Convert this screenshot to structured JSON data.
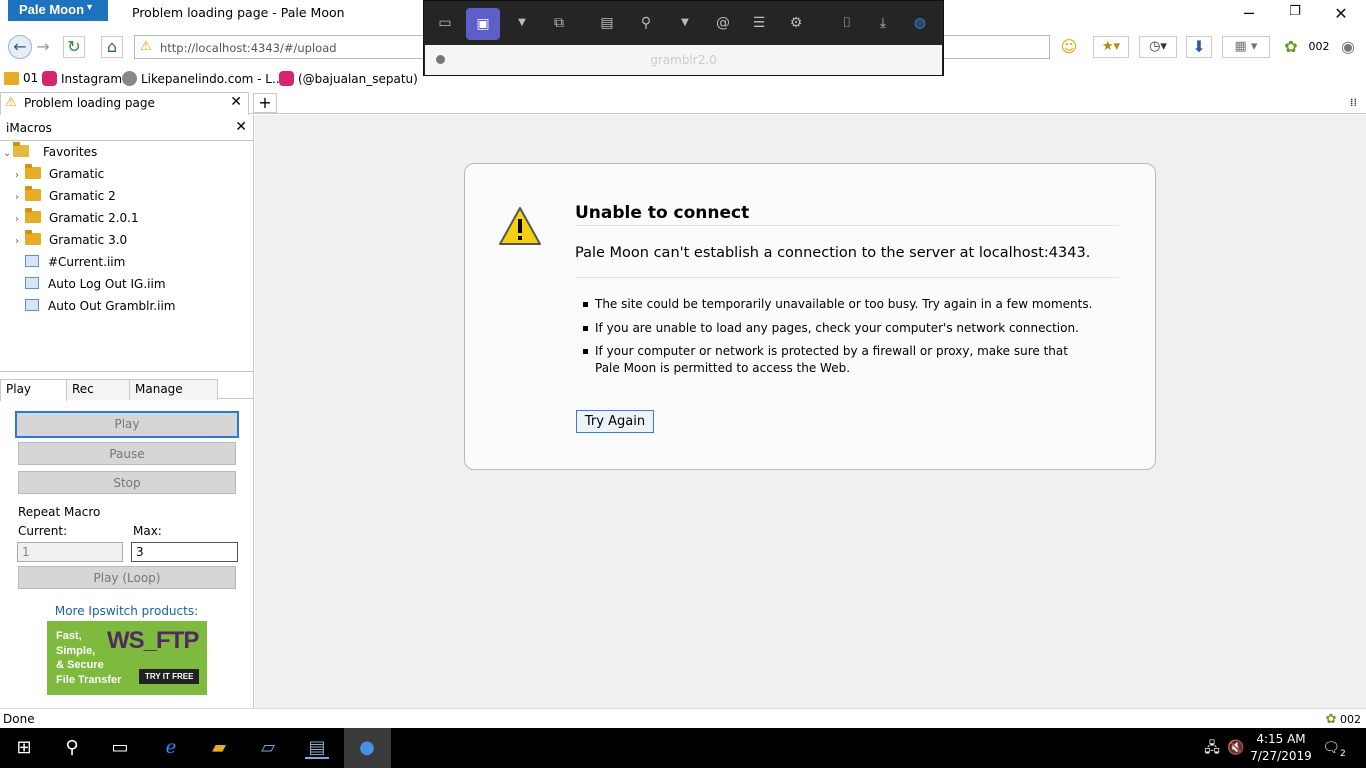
{
  "window": {
    "app_menu_label": "Pale Moon",
    "title": "Problem loading page - Pale Moon"
  },
  "navbar": {
    "url": "http://localhost:4343/#/upload",
    "counter_badge": "002"
  },
  "bookmarks": [
    {
      "label": "01"
    },
    {
      "label": "Instagram"
    },
    {
      "label": "Likepanelindo.com - L..."
    },
    {
      "label": "(@bajualan_sepatu)"
    }
  ],
  "tab": {
    "label": "Problem loading page"
  },
  "sidebar": {
    "title": "iMacros",
    "tree": [
      {
        "label": "Favorites",
        "type": "folder-open"
      },
      {
        "label": "Gramatic",
        "type": "folder"
      },
      {
        "label": "Gramatic 2",
        "type": "folder"
      },
      {
        "label": "Gramatic 2.0.1",
        "type": "folder"
      },
      {
        "label": "Gramatic 3.0",
        "type": "folder"
      },
      {
        "label": "#Current.iim",
        "type": "file"
      },
      {
        "label": "Auto Log Out IG.iim",
        "type": "file"
      },
      {
        "label": "Auto Out Gramblr.iim",
        "type": "file"
      }
    ],
    "tabs": [
      "Play",
      "Rec",
      "Manage"
    ],
    "buttons": {
      "play": "Play",
      "pause": "Pause",
      "stop": "Stop",
      "play_loop": "Play (Loop)"
    },
    "repeat": {
      "title": "Repeat Macro",
      "current_label": "Current:",
      "max_label": "Max:",
      "current_value": "1",
      "max_value": "3"
    },
    "promo_link": "More Ipswitch products:",
    "ad": {
      "line1": "Fast,",
      "line2": "Simple,",
      "line3": "& Secure",
      "line4": "File Transfer",
      "brand": "WS_FTP",
      "cta": "TRY IT FREE"
    }
  },
  "error": {
    "title": "Unable to connect",
    "description": "Pale Moon can't establish a connection to the server at localhost:4343.",
    "bullets": [
      "The site could be temporarily unavailable or too busy. Try again in a few moments.",
      "If you are unable to load any pages, check your computer's network connection.",
      "If your computer or network is protected by a firewall or proxy, make sure that Pale Moon is permitted to access the Web."
    ],
    "button": "Try Again"
  },
  "statusbar": {
    "text": "Done",
    "right_badge": "002"
  },
  "popup": {
    "title": "gramblr2.0"
  },
  "taskbar": {
    "time": "4:15 AM",
    "date": "7/27/2019",
    "notification_count": "2"
  }
}
